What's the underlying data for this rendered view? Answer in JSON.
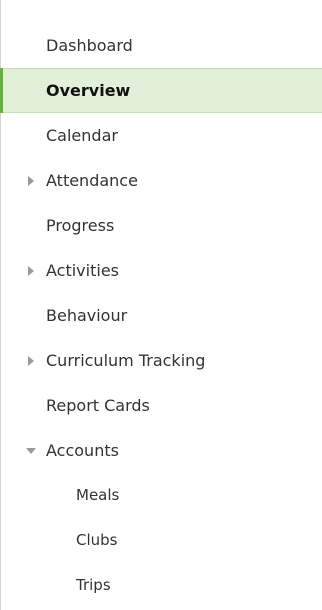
{
  "sidebar": {
    "items": [
      {
        "label": "Dashboard"
      },
      {
        "label": "Overview",
        "active": true
      },
      {
        "label": "Calendar"
      },
      {
        "label": "Attendance",
        "icon": "caret-right-icon"
      },
      {
        "label": "Progress"
      },
      {
        "label": "Activities",
        "icon": "caret-right-icon"
      },
      {
        "label": "Behaviour"
      },
      {
        "label": "Curriculum Tracking",
        "icon": "caret-right-icon"
      },
      {
        "label": "Report Cards"
      },
      {
        "label": "Accounts",
        "icon": "caret-down-icon",
        "expanded": true
      },
      {
        "label": "Meals"
      },
      {
        "label": "Clubs"
      },
      {
        "label": "Trips"
      }
    ]
  },
  "colors": {
    "active_background": "#e2efd9",
    "active_accent": "#6cae4a",
    "text": "#333333",
    "border": "#d3d3d3",
    "caret": "#9a9a9a"
  }
}
